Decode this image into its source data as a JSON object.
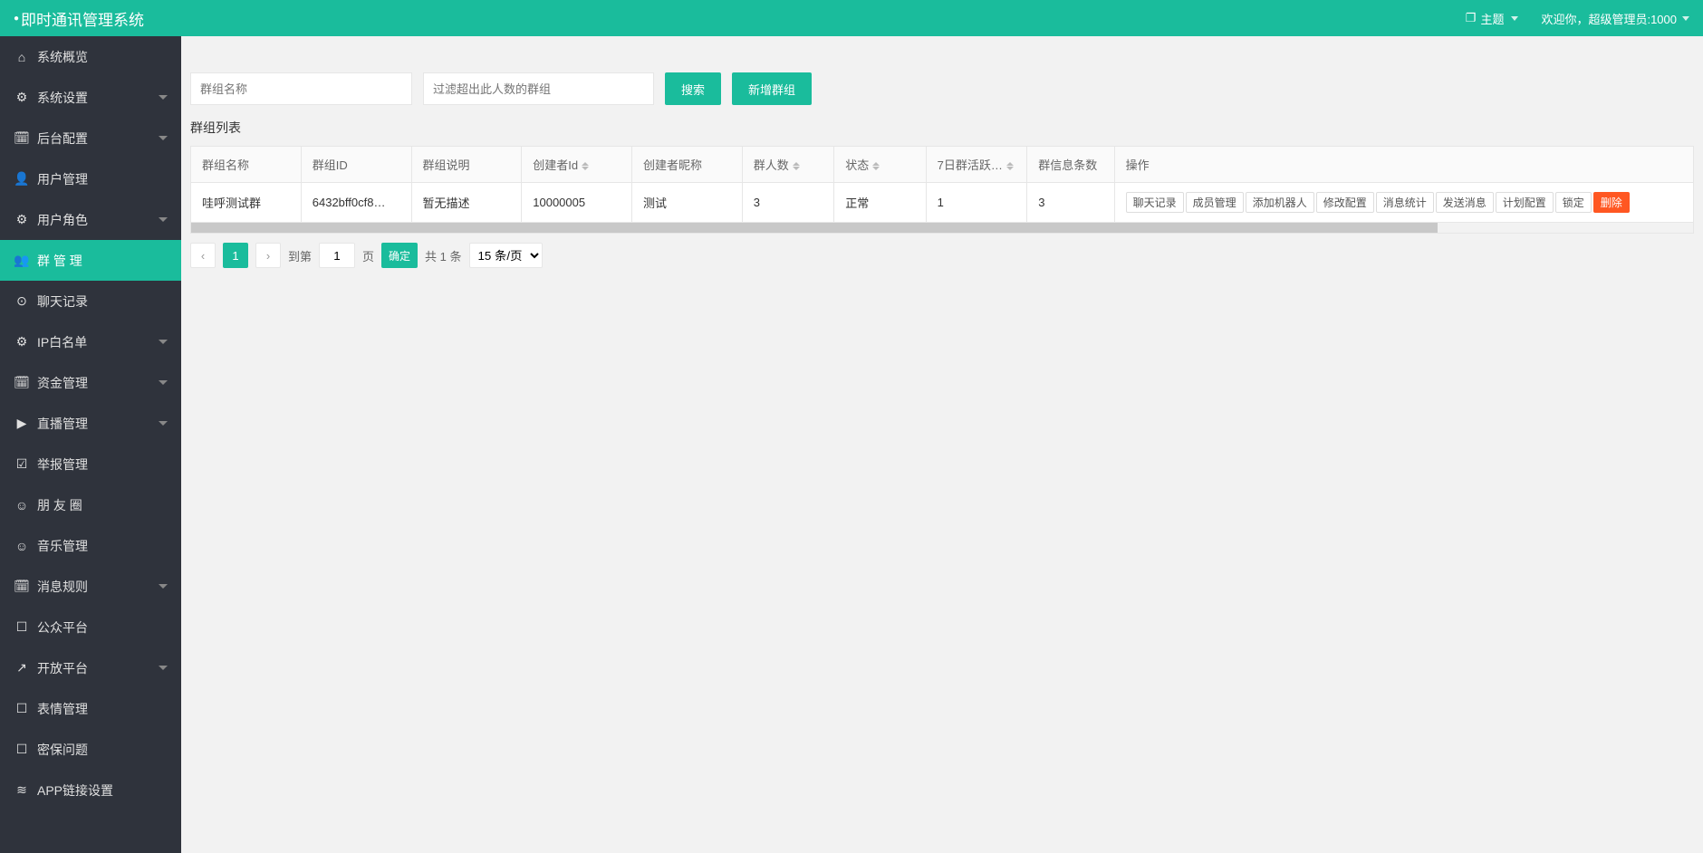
{
  "header": {
    "title": "即时通讯管理系统",
    "theme": "主题",
    "welcome": "欢迎你，超级管理员:1000"
  },
  "sidebar": [
    {
      "icon": "⌂",
      "label": "系统概览",
      "sub": false,
      "active": false
    },
    {
      "icon": "⚙",
      "label": "系统设置",
      "sub": true,
      "active": false
    },
    {
      "icon": "🗓",
      "label": "后台配置",
      "sub": true,
      "active": false
    },
    {
      "icon": "👤",
      "label": "用户管理",
      "sub": false,
      "active": false
    },
    {
      "icon": "⚙",
      "label": "用户角色",
      "sub": true,
      "active": false
    },
    {
      "icon": "👥",
      "label": "群 管 理",
      "sub": false,
      "active": true
    },
    {
      "icon": "⊙",
      "label": "聊天记录",
      "sub": false,
      "active": false
    },
    {
      "icon": "⚙",
      "label": "IP白名单",
      "sub": true,
      "active": false
    },
    {
      "icon": "🗓",
      "label": "资金管理",
      "sub": true,
      "active": false
    },
    {
      "icon": "▶",
      "label": "直播管理",
      "sub": true,
      "active": false
    },
    {
      "icon": "☑",
      "label": "举报管理",
      "sub": false,
      "active": false
    },
    {
      "icon": "☺",
      "label": "朋 友 圈",
      "sub": false,
      "active": false
    },
    {
      "icon": "☺",
      "label": "音乐管理",
      "sub": false,
      "active": false
    },
    {
      "icon": "🗓",
      "label": "消息规则",
      "sub": true,
      "active": false
    },
    {
      "icon": "☐",
      "label": "公众平台",
      "sub": false,
      "active": false
    },
    {
      "icon": "↗",
      "label": "开放平台",
      "sub": true,
      "active": false
    },
    {
      "icon": "☐",
      "label": "表情管理",
      "sub": false,
      "active": false
    },
    {
      "icon": "☐",
      "label": "密保问题",
      "sub": false,
      "active": false
    },
    {
      "icon": "≋",
      "label": "APP链接设置",
      "sub": false,
      "active": false
    }
  ],
  "search": {
    "name_placeholder": "群组名称",
    "filter_placeholder": "过滤超出此人数的群组",
    "search_btn": "搜索",
    "add_btn": "新增群组"
  },
  "section_title": "群组列表",
  "columns": [
    "群组名称",
    "群组ID",
    "群组说明",
    "创建者Id",
    "创建者昵称",
    "群人数",
    "状态",
    "7日群活跃…",
    "群信息条数",
    "操作"
  ],
  "rows": [
    {
      "name": "哇呼测试群",
      "id": "6432bff0cf8…",
      "desc": "暂无描述",
      "creator_id": "10000005",
      "creator_nick": "测试",
      "members": "3",
      "status": "正常",
      "activity": "1",
      "msgs": "3"
    }
  ],
  "actions": [
    "聊天记录",
    "成员管理",
    "添加机器人",
    "修改配置",
    "消息统计",
    "发送消息",
    "计划配置",
    "锁定",
    "删除"
  ],
  "pagination": {
    "page": "1",
    "goto_label": "到第",
    "goto_value": "1",
    "page_label": "页",
    "confirm": "确定",
    "total": "共 1 条",
    "per_page": "15 条/页"
  }
}
